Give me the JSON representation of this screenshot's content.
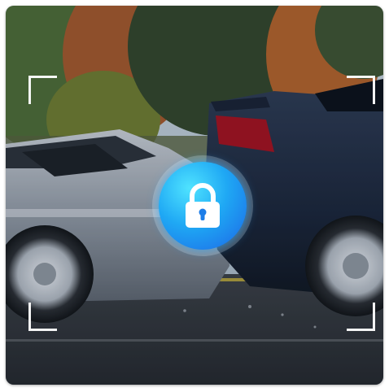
{
  "image": {
    "alt_subject": "car-collision-photo"
  },
  "colors": {
    "badge_light": "#4fe3ff",
    "badge_mid": "#1fa8f4",
    "badge_dark": "#1c66e6",
    "bracket": "#ffffff"
  },
  "icons": {
    "center": "lock-icon",
    "corners": "viewfinder-bracket-icon"
  }
}
